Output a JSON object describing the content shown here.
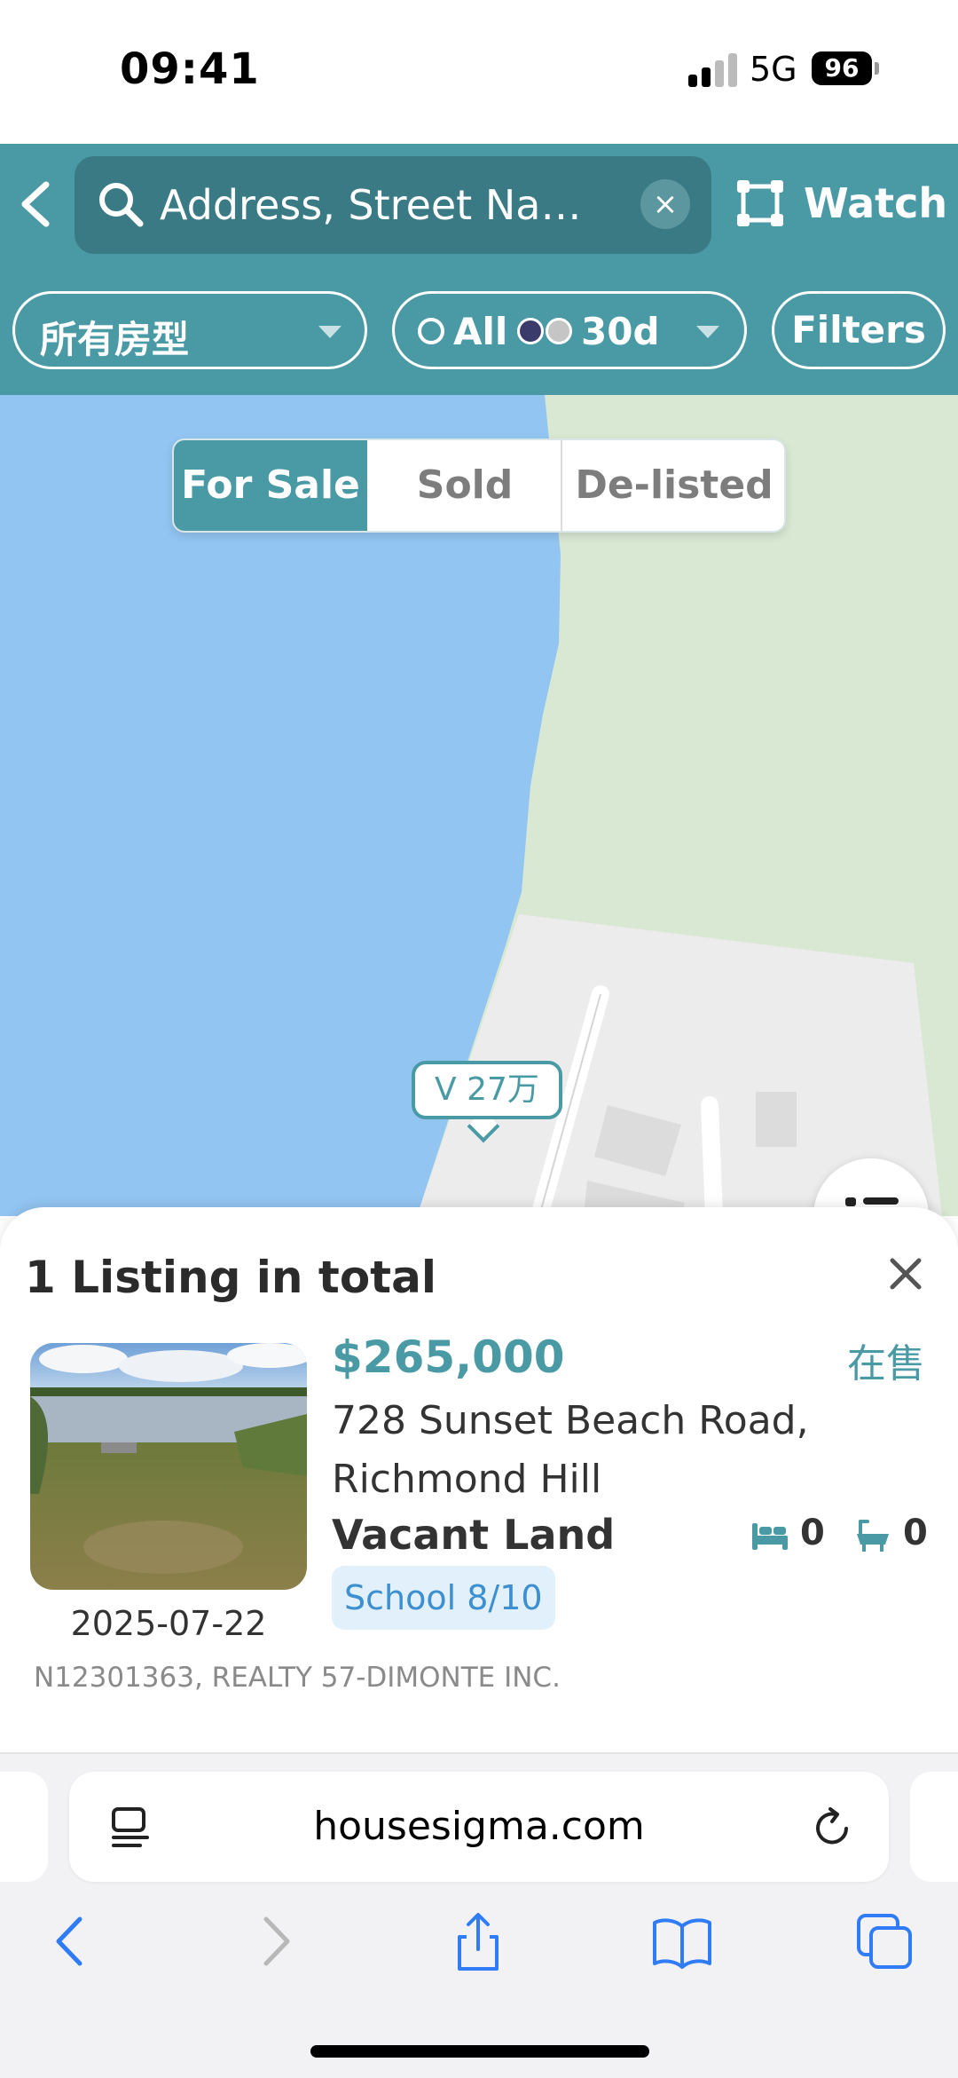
{
  "status_bar": {
    "time": "09:41",
    "network": "5G",
    "battery": "96"
  },
  "header": {
    "search_placeholder": "Address, Street Name ...",
    "clear_symbol": "×",
    "watch_label": "Watch",
    "property_type": "所有房型",
    "status_filter": {
      "all_label": "All",
      "period_label": "30d"
    },
    "filters_label": "Filters",
    "colors": {
      "header_bg": "#4a9aa5",
      "search_bg": "#3a7a84"
    }
  },
  "map": {
    "tabs": [
      {
        "label": "For Sale",
        "active": true
      },
      {
        "label": "Sold",
        "active": false
      },
      {
        "label": "De-listed",
        "active": false
      }
    ],
    "pin_label": "V 27万",
    "colors": {
      "water": "#93c5f2",
      "park": "#d8e8d3",
      "land": "#eeeeee"
    }
  },
  "sheet": {
    "title": "1 Listing in total",
    "listing": {
      "price": "$265,000",
      "status": "在售",
      "address": "728 Sunset Beach Road, Richmond Hill",
      "type": "Vacant Land",
      "beds": "0",
      "baths": "0",
      "school": "School 8/10",
      "date": "2025-07-22",
      "mls": "N12301363, REALTY 57-DIMONTE INC."
    }
  },
  "browser": {
    "url": "housesigma.com",
    "toolbar": [
      "back-icon",
      "forward-icon",
      "share-icon",
      "bookmarks-icon",
      "tabs-icon"
    ]
  }
}
